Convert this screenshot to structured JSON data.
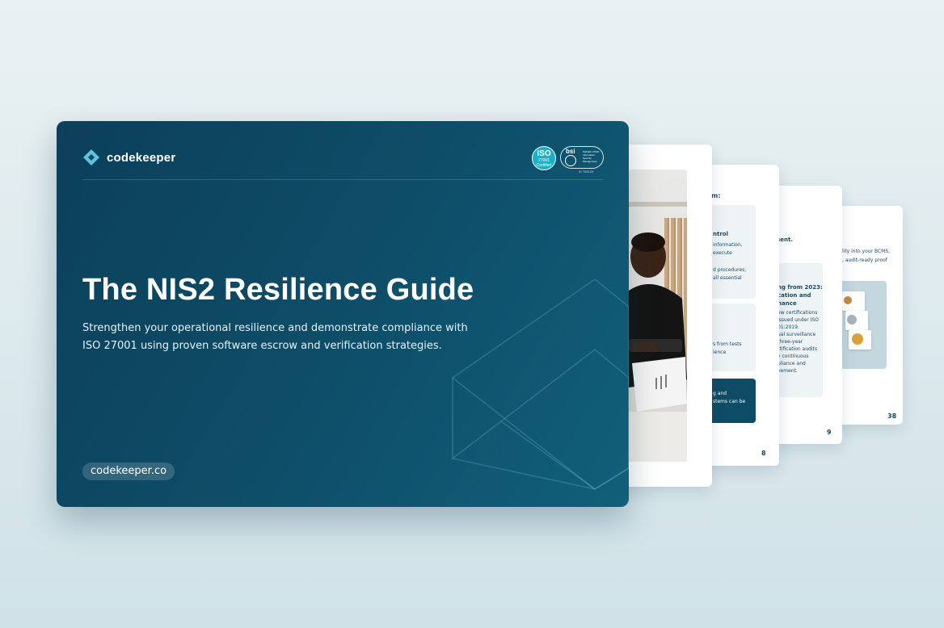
{
  "cover": {
    "brand_name": "codekeeper",
    "cert_iso": {
      "line1": "ISO",
      "line2": "27001",
      "line3": "Certified"
    },
    "cert_bsi": {
      "name": "bsi",
      "detail": "ISO/IEC 27001 Information Security Management"
    },
    "cert_caption": "IS 785125",
    "title": "The NIS2 Resilience Guide",
    "subtitle": "Strengthen your operational resilience and demonstrate compliance with ISO 27001 using proven software escrow and verification strategies.",
    "url": "codekeeper.co"
  },
  "pages": [
    {
      "number": "",
      "lines": []
    },
    {
      "number": "8",
      "lines": [
        "m:",
        "ntrol",
        "information,",
        "execute",
        "d procedures,",
        "all essential",
        "s from tests",
        "ience",
        "g and",
        "stems can be"
      ]
    },
    {
      "number": "9",
      "lines": [
        "ment.",
        "ng from 2023:",
        "cation and",
        "nance",
        "ew certifications",
        "issued under ISO",
        "01:2019.",
        "ual surveillance",
        "three-year",
        "rtification audits",
        "y continuous",
        "pliance and",
        "vement."
      ]
    },
    {
      "number": "38",
      "lines": [
        "lity into your BCMS,",
        ", audit-ready proof"
      ]
    }
  ],
  "colors": {
    "cover_bg": "#0e4d68",
    "accent": "#5fc3dc",
    "page_text": "#1b4b63"
  }
}
